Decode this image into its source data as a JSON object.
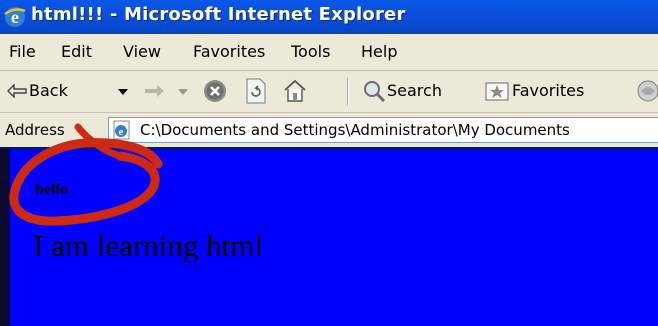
{
  "window": {
    "title": "html!!! - Microsoft Internet Explorer"
  },
  "menu": {
    "items": [
      "File",
      "Edit",
      "View",
      "Favorites",
      "Tools",
      "Help"
    ]
  },
  "toolbar": {
    "back_label": "Back",
    "search_label": "Search",
    "favorites_label": "Favorites",
    "icons": [
      "back-arrow-icon",
      "dropdown-icon",
      "forward-arrow-icon",
      "dropdown-icon",
      "stop-icon",
      "refresh-icon",
      "home-icon",
      "search-icon",
      "favorites-icon",
      "media-icon"
    ]
  },
  "address": {
    "label": "Address",
    "url": "C:\\Documents and Settings\\Administrator\\My Documents"
  },
  "page": {
    "heading": "hello",
    "text": "I am learning html",
    "background": "#0000ff"
  },
  "annotation": {
    "color": "#cc2a14"
  }
}
